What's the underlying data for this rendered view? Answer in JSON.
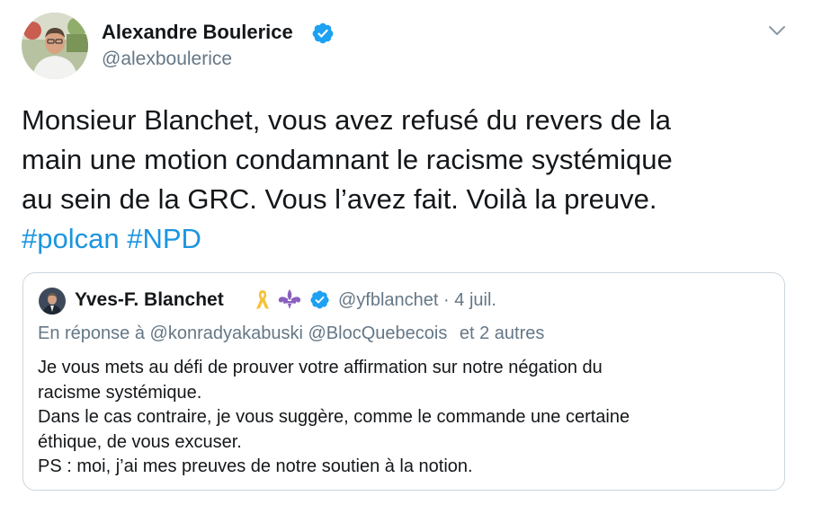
{
  "tweet": {
    "author": {
      "name": "Alexandre Boulerice",
      "handle": "@alexboulerice",
      "verified": true
    },
    "text_lines": [
      "Monsieur Blanchet, vous avez refusé du revers de la",
      "main une motion condamnant le racisme systémique",
      "au sein de la GRC. Vous l’avez fait. Voilà la preuve."
    ],
    "hashtags": [
      "#polcan",
      "#NPD"
    ],
    "menu_icon": "chevron-down-icon"
  },
  "quoted_tweet": {
    "author": {
      "name": "Yves-F. Blanchet",
      "handle": "@yfblanchet",
      "separator": "·",
      "date": "4 juil.",
      "verified": true,
      "emoji_icons": [
        "yellow-ribbon-icon",
        "fleur-de-lis-icon"
      ]
    },
    "reply_context": {
      "prefix": "En réponse à",
      "mentions": [
        "@konradyakabuski",
        "@BlocQuebecois"
      ],
      "suffix": "et 2 autres"
    },
    "text_lines": [
      "Je vous mets au défi de prouver votre affirmation sur notre négation du",
      "racisme systémique.",
      "Dans le cas contraire, je vous suggère, comme le commande une certaine",
      "éthique, de vous excuser.",
      "PS : moi, j’ai mes preuves de notre soutien à la notion."
    ]
  },
  "colors": {
    "text": "#14171a",
    "secondary": "#657786",
    "link": "#1b95e0",
    "verified": "#1da1f2",
    "border": "#ccd6dd"
  }
}
